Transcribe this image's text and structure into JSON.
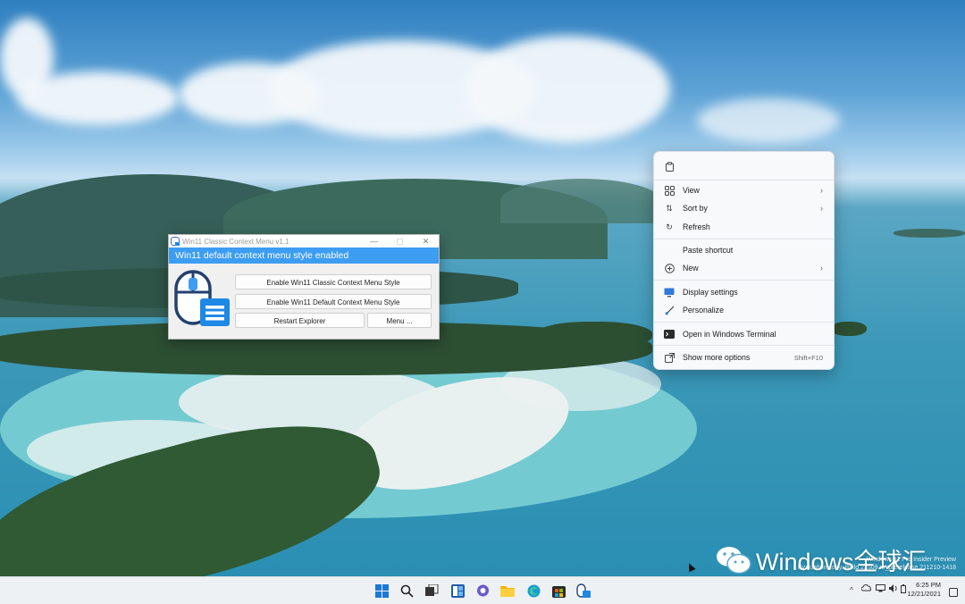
{
  "tool_window": {
    "title": "Win11 Classic Context Menu v1.1",
    "status": "Win11 default context menu style enabled",
    "buttons": {
      "enable_classic": "Enable Win11 Classic Context Menu Style",
      "enable_default": "Enable Win11 Default Context Menu Style",
      "restart_explorer": "Restart Explorer",
      "menu": "Menu ..."
    },
    "controls": {
      "minimize": "—",
      "maximize": "▢",
      "close": "✕"
    }
  },
  "context_menu": {
    "items": [
      {
        "label": "View",
        "icon": "grid-icon",
        "submenu": true
      },
      {
        "label": "Sort by",
        "icon": "sort-icon",
        "submenu": true
      },
      {
        "label": "Refresh",
        "icon": "refresh-icon"
      },
      {
        "label": "Paste shortcut",
        "icon": ""
      },
      {
        "label": "New",
        "icon": "plus-circle-icon",
        "submenu": true
      },
      {
        "label": "Display settings",
        "icon": "display-icon"
      },
      {
        "label": "Personalize",
        "icon": "brush-icon"
      },
      {
        "label": "Open in Windows Terminal",
        "icon": "terminal-icon"
      },
      {
        "label": "Show more options",
        "icon": "share-icon",
        "shortcut": "Shift+F10"
      }
    ]
  },
  "watermark": {
    "line1": "Windows 11 Pro Insider Preview",
    "line2": "Evaluation copy. Build 22509.rs_prerelease.211210-1418"
  },
  "wechat": {
    "text": "Windows全球汇"
  },
  "taskbar": {
    "apps": [
      "start-icon",
      "search-icon",
      "task-view-icon",
      "widgets-icon",
      "chat-icon",
      "file-explorer-icon",
      "edge-icon",
      "store-icon",
      "context-menu-tool-icon"
    ],
    "tray": {
      "chevron": "^"
    },
    "time": "6:25 PM",
    "date": "12/21/2021"
  },
  "colors": {
    "accent": "#3d9df2",
    "menu_bg": "#f7f9fb",
    "taskbar_bg": "#eef1f4"
  }
}
